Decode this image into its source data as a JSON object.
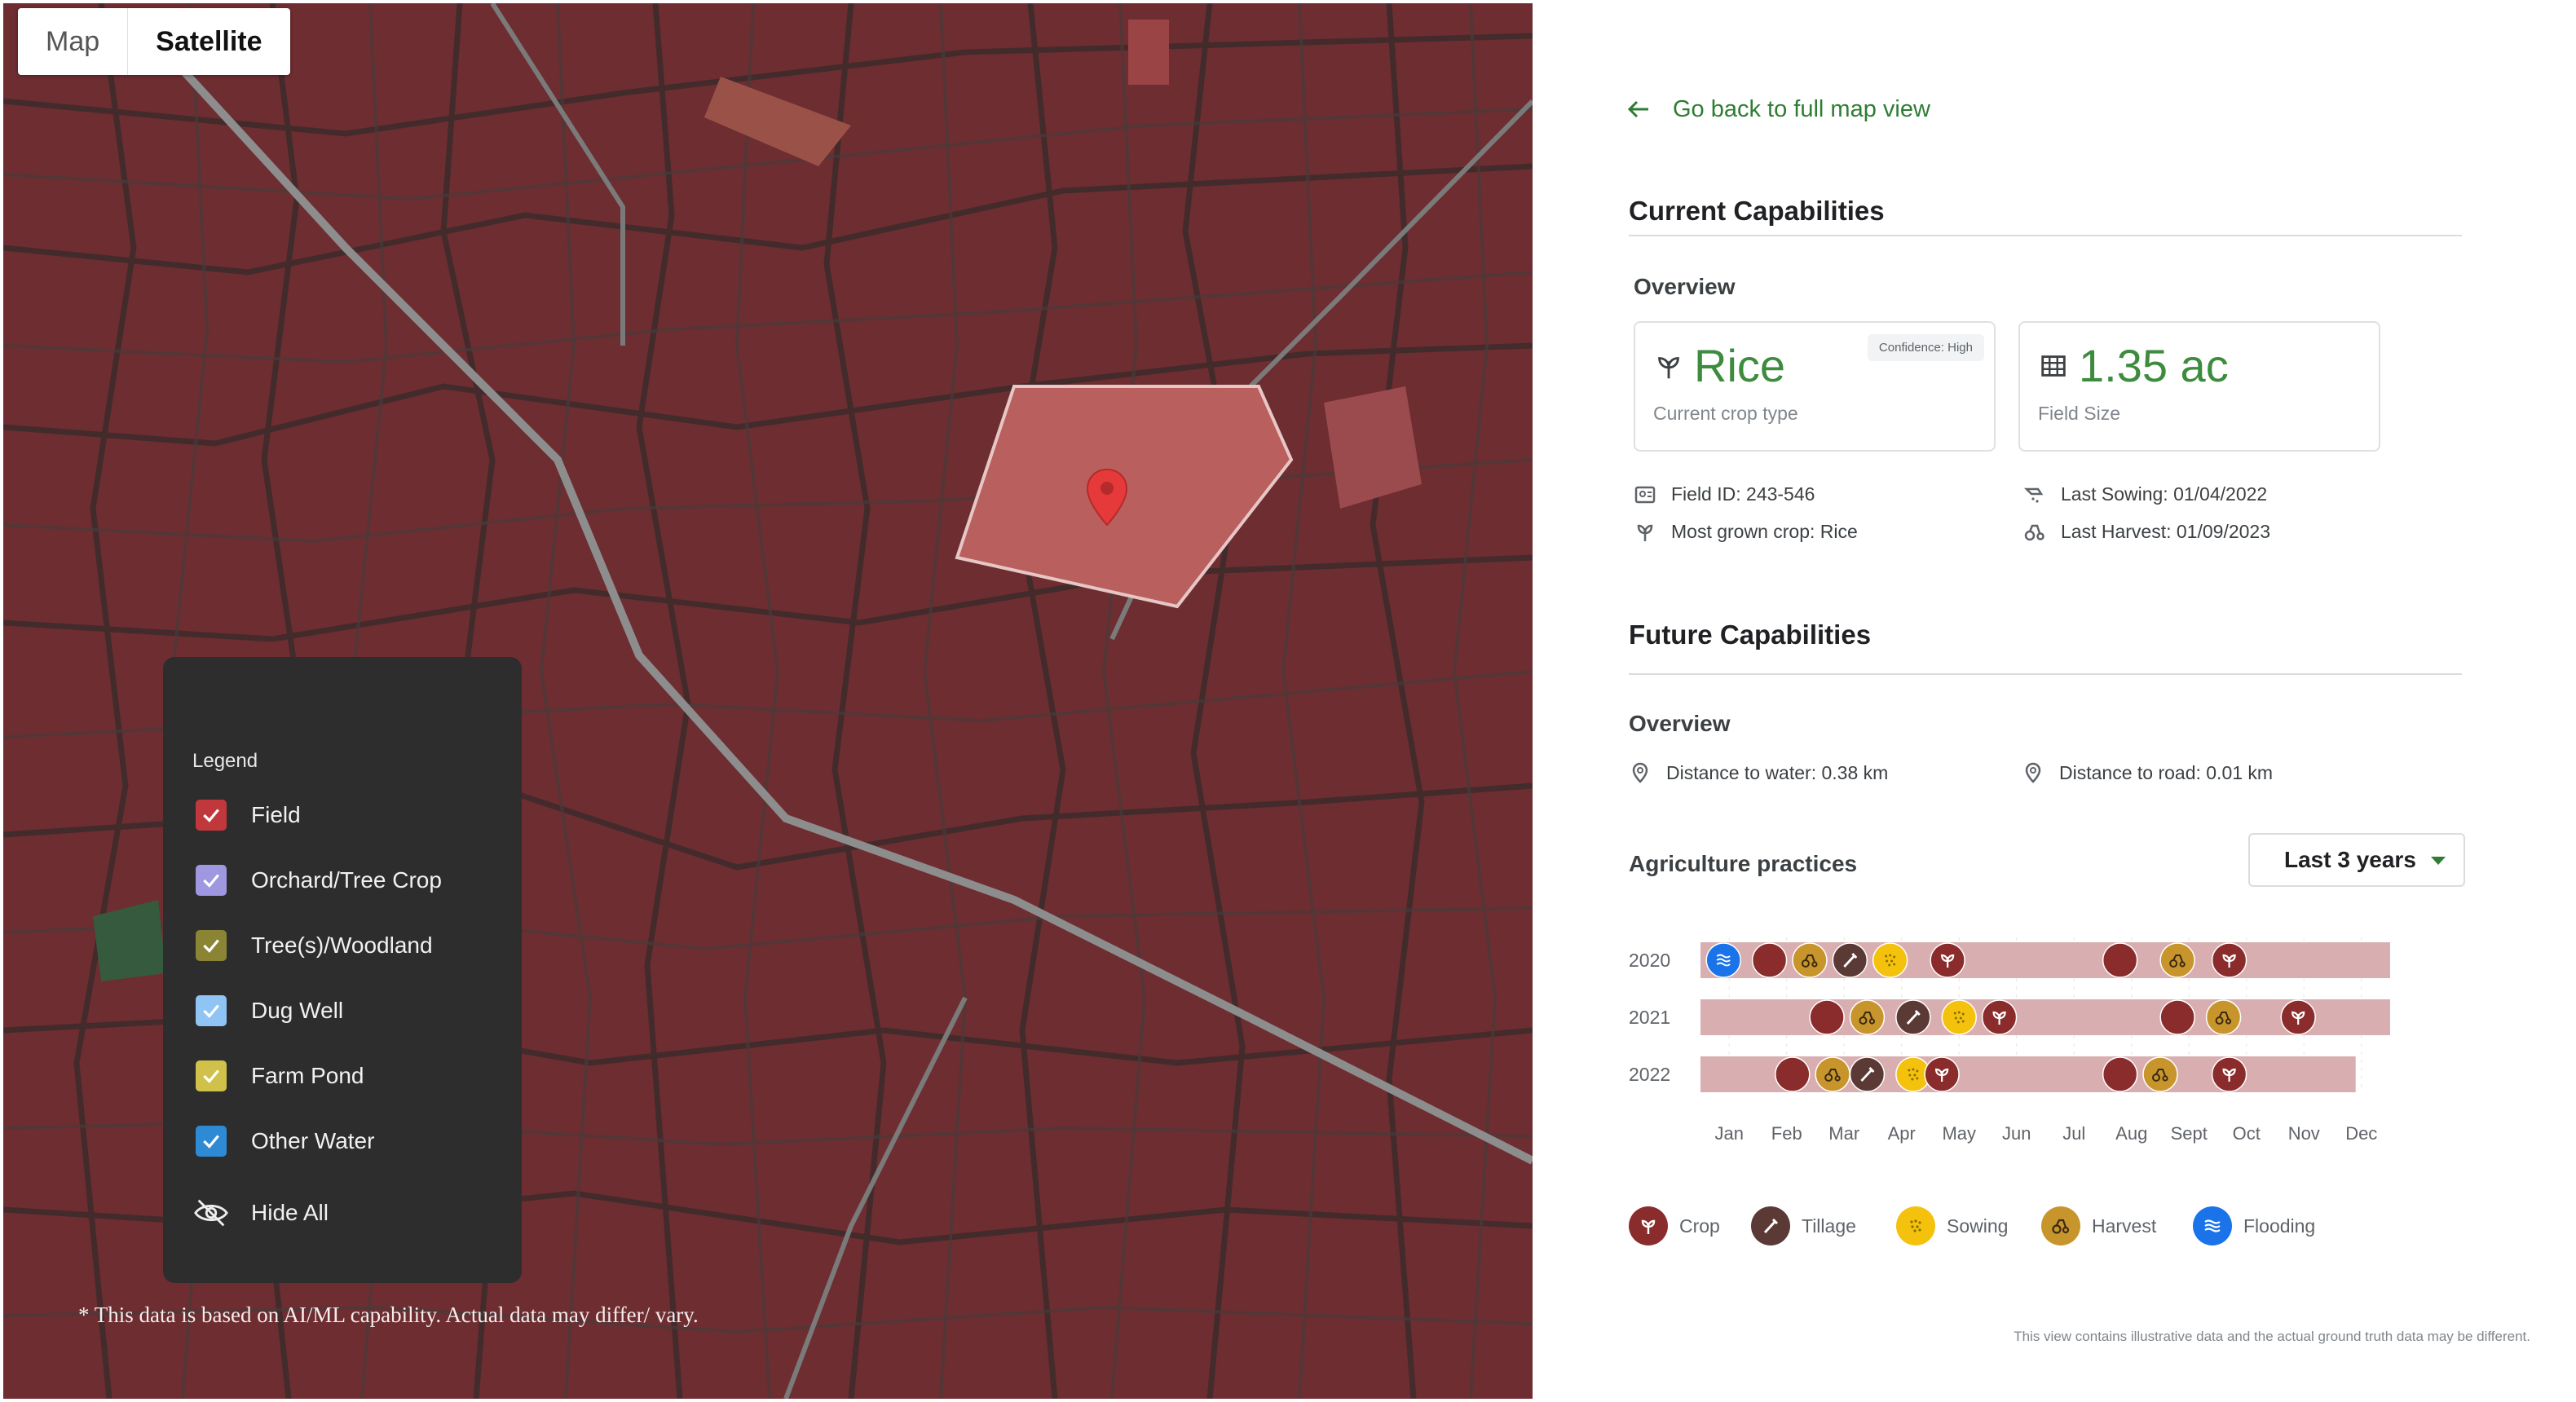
{
  "map": {
    "toggle": {
      "map_label": "Map",
      "satellite_label": "Satellite",
      "active": "Satellite"
    },
    "legend": {
      "title": "Legend",
      "items": [
        {
          "label": "Field",
          "color": "#c0383b"
        },
        {
          "label": "Orchard/Tree Crop",
          "color": "#9f97e0"
        },
        {
          "label": "Tree(s)/Woodland",
          "color": "#8a8434"
        },
        {
          "label": "Dug Well",
          "color": "#8fc4f5"
        },
        {
          "label": "Farm Pond",
          "color": "#cfc14a"
        },
        {
          "label": "Other Water",
          "color": "#2f8ad6"
        }
      ],
      "hide_all_label": "Hide All"
    },
    "disclaimer": "* This data is based on AI/ML capability. Actual data may differ/ vary."
  },
  "panel": {
    "back_link": "Go back to full map view",
    "current": {
      "title": "Current Capabilities",
      "overview_label": "Overview",
      "crop_card": {
        "value": "Rice",
        "caption": "Current crop type",
        "badge": "Confidence: High"
      },
      "size_card": {
        "value": "1.35 ac",
        "caption": "Field Size"
      },
      "field_id": "Field ID: 243-546",
      "most_grown": "Most grown crop: Rice",
      "last_sowing": "Last Sowing: 01/04/2022",
      "last_harvest": "Last Harvest: 01/09/2023"
    },
    "future": {
      "title": "Future Capabilities",
      "overview_label": "Overview",
      "distance_water": "Distance to water: 0.38 km",
      "distance_road": "Distance to road: 0.01 km",
      "practices_label": "Agriculture practices",
      "range_select": "Last 3 years"
    },
    "footnote": "This view contains illustrative data and the actual ground truth data may be different."
  },
  "chart_data": {
    "type": "timeline",
    "months": [
      "Jan",
      "Feb",
      "Mar",
      "Apr",
      "May",
      "Jun",
      "Jul",
      "Aug",
      "Sept",
      "Oct",
      "Nov",
      "Dec"
    ],
    "categories": [
      "Crop",
      "Tillage",
      "Sowing",
      "Harvest",
      "Flooding"
    ],
    "colors": {
      "Crop": "#8b2c2c",
      "Tillage": "#5b3a36",
      "Sowing": "#f4c20d",
      "Harvest": "#c8952d",
      "Flooding": "#1a73e8",
      "track": "#d9aeb0"
    },
    "rows": [
      {
        "year": "2020",
        "track": [
          0.0,
          12.0
        ],
        "events": [
          {
            "type": "Flooding",
            "month": 0.4
          },
          {
            "type": "blank",
            "month": 1.2
          },
          {
            "type": "Harvest",
            "month": 1.9
          },
          {
            "type": "Tillage",
            "month": 2.6
          },
          {
            "type": "Sowing",
            "month": 3.3
          },
          {
            "type": "Crop",
            "month": 4.3
          },
          {
            "type": "blank",
            "month": 7.3
          },
          {
            "type": "Harvest",
            "month": 8.3
          },
          {
            "type": "Crop",
            "month": 9.2
          }
        ]
      },
      {
        "year": "2021",
        "track": [
          0.0,
          12.0
        ],
        "events": [
          {
            "type": "blank",
            "month": 2.2
          },
          {
            "type": "Harvest",
            "month": 2.9
          },
          {
            "type": "Tillage",
            "month": 3.7
          },
          {
            "type": "Sowing",
            "month": 4.5
          },
          {
            "type": "Crop",
            "month": 5.2
          },
          {
            "type": "blank",
            "month": 8.3
          },
          {
            "type": "Harvest",
            "month": 9.1
          },
          {
            "type": "Crop",
            "month": 10.4
          }
        ]
      },
      {
        "year": "2022",
        "track": [
          0.0,
          11.4
        ],
        "events": [
          {
            "type": "blank",
            "month": 1.6
          },
          {
            "type": "Harvest",
            "month": 2.3
          },
          {
            "type": "Tillage",
            "month": 2.9
          },
          {
            "type": "Sowing",
            "month": 3.7
          },
          {
            "type": "Crop",
            "month": 4.2
          },
          {
            "type": "blank",
            "month": 7.3
          },
          {
            "type": "Harvest",
            "month": 8.0
          },
          {
            "type": "Crop",
            "month": 9.2
          }
        ]
      }
    ]
  }
}
